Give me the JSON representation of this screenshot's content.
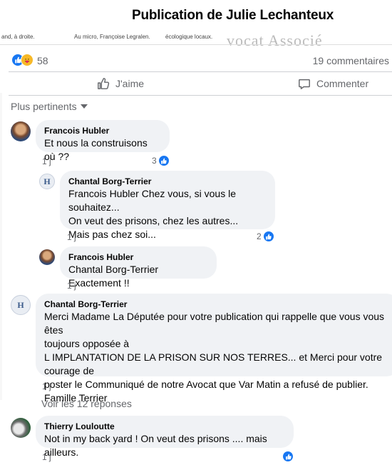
{
  "header": {
    "title": "Publication de Julie Lechanteux"
  },
  "post_strip": {
    "snippet_left": "and, à droite.",
    "snippet_mid": "Au micro, Françoise Legralen.",
    "snippet_right": "écologique locaux.",
    "snippet_big": "vocat Associé"
  },
  "reactions": {
    "count": "58",
    "comments_count": "19 commentaires",
    "icons": [
      "like-icon",
      "care-icon"
    ],
    "colors": {
      "like": "#1877f2",
      "care": "#f7b928"
    }
  },
  "actions": {
    "like_label": "J'aime",
    "comment_label": "Commenter"
  },
  "sort": {
    "label": "Plus pertinents"
  },
  "comments": [
    {
      "author": "Francois Hubler",
      "text": "Et nous la construisons où ??",
      "time": "1 j",
      "likes": "3"
    },
    {
      "author": "Chantal Borg-Terrier",
      "text": "Francois Hubler Chez vous, si vous le souhaitez...\nOn veut des prisons, chez les autres...\nMais pas chez soi...",
      "time": "1 j",
      "likes": "2"
    },
    {
      "author": "Francois Hubler",
      "text": "Chantal Borg-Terrier Exactement !!",
      "time": "1 j",
      "likes": ""
    },
    {
      "author": "Chantal Borg-Terrier",
      "text": "Merci Madame La Députée pour votre publication qui rappelle que vous vous êtes\ntoujours opposée à\nL IMPLANTATION DE LA PRISON SUR NOS TERRES... et Merci pour votre courage de\nposter le Communiqué de notre Avocat que Var Matin a refusé de publier.\nFamille Terrier",
      "time": "1 j",
      "likes": ""
    },
    {
      "author": "Thierry Louloutte",
      "text": "Not in my back yard ! On veut des prisons .... mais ailleurs.",
      "time": "1 j",
      "likes": ""
    }
  ],
  "replies_link": "Voir les 12 réponses",
  "logo_letter": "H"
}
